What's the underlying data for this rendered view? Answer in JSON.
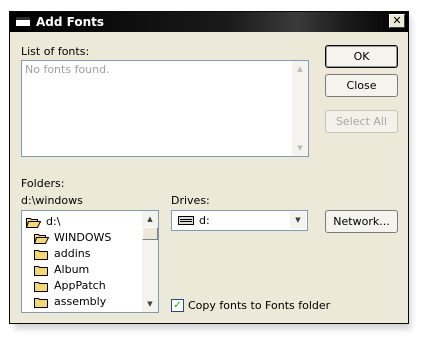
{
  "window": {
    "title": "Add Fonts",
    "close_glyph": "✕"
  },
  "fonts": {
    "label": "List of fonts:",
    "empty_text": "No fonts found."
  },
  "buttons": {
    "ok": "OK",
    "close": "Close",
    "select_all": "Select All",
    "network": "Network..."
  },
  "folders": {
    "label": "Folders:",
    "current_path": "d:\\windows",
    "tree": [
      {
        "name": "d:\\",
        "icon": "open-folder-icon"
      },
      {
        "name": "WINDOWS",
        "icon": "open-folder-icon"
      },
      {
        "name": "addins",
        "icon": "folder-icon"
      },
      {
        "name": "Album",
        "icon": "folder-icon"
      },
      {
        "name": "AppPatch",
        "icon": "folder-icon"
      },
      {
        "name": "assembly",
        "icon": "folder-icon"
      }
    ]
  },
  "drives": {
    "label": "Drives:",
    "selected": "d:",
    "icon": "drive-icon"
  },
  "copy_option": {
    "label": "Copy fonts to Fonts folder",
    "checked": true,
    "check_glyph": "✓"
  },
  "colors": {
    "dialog_bg": "#ece9d8",
    "titlebar": "#000000",
    "field_border": "#7f9db9",
    "folder_yellow": "#f5d86a"
  }
}
